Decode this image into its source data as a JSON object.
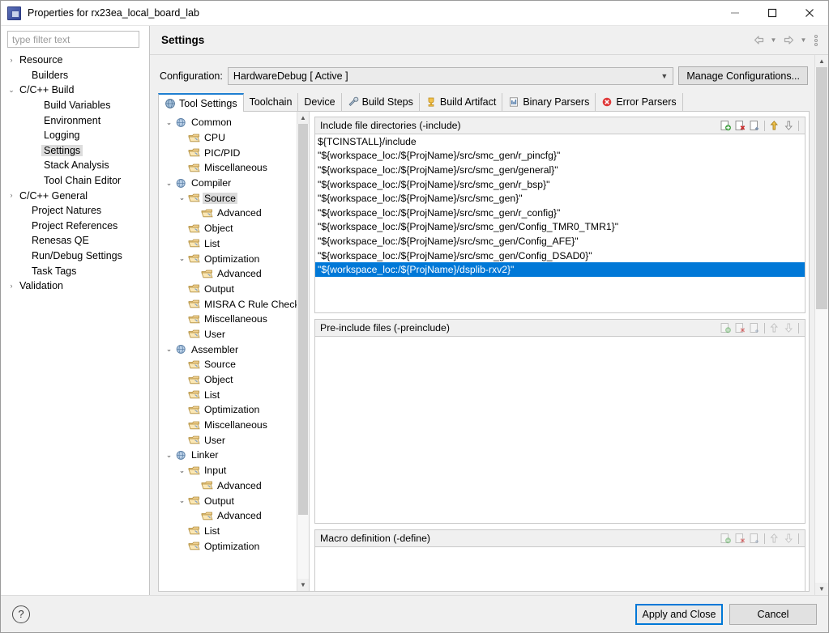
{
  "window": {
    "title": "Properties for rx23ea_local_board_lab",
    "app_icon": "chip-icon",
    "minimize_label": "—",
    "maximize_label": "□",
    "close_label": "✕"
  },
  "filter": {
    "placeholder": "type filter text",
    "value": ""
  },
  "sidebar": {
    "items": [
      {
        "label": "Resource",
        "indent": 0,
        "arrow": "collapsed",
        "selected": false
      },
      {
        "label": "Builders",
        "indent": 1,
        "arrow": "none",
        "selected": false
      },
      {
        "label": "C/C++ Build",
        "indent": 0,
        "arrow": "expanded",
        "selected": false
      },
      {
        "label": "Build Variables",
        "indent": 2,
        "arrow": "none",
        "selected": false
      },
      {
        "label": "Environment",
        "indent": 2,
        "arrow": "none",
        "selected": false
      },
      {
        "label": "Logging",
        "indent": 2,
        "arrow": "none",
        "selected": false
      },
      {
        "label": "Settings",
        "indent": 2,
        "arrow": "none",
        "selected": true
      },
      {
        "label": "Stack Analysis",
        "indent": 2,
        "arrow": "none",
        "selected": false
      },
      {
        "label": "Tool Chain Editor",
        "indent": 2,
        "arrow": "none",
        "selected": false
      },
      {
        "label": "C/C++ General",
        "indent": 0,
        "arrow": "collapsed",
        "selected": false
      },
      {
        "label": "Project Natures",
        "indent": 1,
        "arrow": "none",
        "selected": false
      },
      {
        "label": "Project References",
        "indent": 1,
        "arrow": "none",
        "selected": false
      },
      {
        "label": "Renesas QE",
        "indent": 1,
        "arrow": "none",
        "selected": false
      },
      {
        "label": "Run/Debug Settings",
        "indent": 1,
        "arrow": "none",
        "selected": false
      },
      {
        "label": "Task Tags",
        "indent": 1,
        "arrow": "none",
        "selected": false
      },
      {
        "label": "Validation",
        "indent": 0,
        "arrow": "collapsed",
        "selected": false
      }
    ]
  },
  "header": {
    "title": "Settings",
    "back_icon": "back-arrow-icon",
    "back_caret_icon": "chevron-down-icon",
    "forward_icon": "forward-arrow-icon",
    "forward_caret_icon": "chevron-down-icon",
    "menu_icon": "view-menu-icon"
  },
  "config": {
    "label": "Configuration:",
    "value": "HardwareDebug  [ Active ]",
    "caret_icon": "chevron-down-icon",
    "manage_button": "Manage Configurations..."
  },
  "tabs": [
    {
      "label": "Tool Settings",
      "icon": "tool-settings-icon",
      "active": true
    },
    {
      "label": "Toolchain",
      "icon": "none",
      "active": false
    },
    {
      "label": "Device",
      "icon": "none",
      "active": false
    },
    {
      "label": "Build Steps",
      "icon": "build-steps-icon",
      "active": false
    },
    {
      "label": "Build Artifact",
      "icon": "trophy-icon",
      "active": false
    },
    {
      "label": "Binary Parsers",
      "icon": "binary-parsers-icon",
      "active": false
    },
    {
      "label": "Error Parsers",
      "icon": "error-parsers-icon",
      "active": false
    }
  ],
  "tool_tree": [
    {
      "label": "Common",
      "indent": 0,
      "arrow": "expanded",
      "icon": "globe-icon",
      "selected": false
    },
    {
      "label": "CPU",
      "indent": 1,
      "arrow": "none",
      "icon": "folder-icon",
      "selected": false
    },
    {
      "label": "PIC/PID",
      "indent": 1,
      "arrow": "none",
      "icon": "folder-icon",
      "selected": false
    },
    {
      "label": "Miscellaneous",
      "indent": 1,
      "arrow": "none",
      "icon": "folder-icon",
      "selected": false
    },
    {
      "label": "Compiler",
      "indent": 0,
      "arrow": "expanded",
      "icon": "globe-icon",
      "selected": false
    },
    {
      "label": "Source",
      "indent": 1,
      "arrow": "expanded",
      "icon": "folder-icon",
      "selected": true
    },
    {
      "label": "Advanced",
      "indent": 2,
      "arrow": "none",
      "icon": "folder-icon",
      "selected": false
    },
    {
      "label": "Object",
      "indent": 1,
      "arrow": "none",
      "icon": "folder-icon",
      "selected": false
    },
    {
      "label": "List",
      "indent": 1,
      "arrow": "none",
      "icon": "folder-icon",
      "selected": false
    },
    {
      "label": "Optimization",
      "indent": 1,
      "arrow": "expanded",
      "icon": "folder-icon",
      "selected": false
    },
    {
      "label": "Advanced",
      "indent": 2,
      "arrow": "none",
      "icon": "folder-icon",
      "selected": false
    },
    {
      "label": "Output",
      "indent": 1,
      "arrow": "none",
      "icon": "folder-icon",
      "selected": false
    },
    {
      "label": "MISRA C Rule Check",
      "indent": 1,
      "arrow": "none",
      "icon": "folder-icon",
      "selected": false
    },
    {
      "label": "Miscellaneous",
      "indent": 1,
      "arrow": "none",
      "icon": "folder-icon",
      "selected": false
    },
    {
      "label": "User",
      "indent": 1,
      "arrow": "none",
      "icon": "folder-icon",
      "selected": false
    },
    {
      "label": "Assembler",
      "indent": 0,
      "arrow": "expanded",
      "icon": "globe-icon",
      "selected": false
    },
    {
      "label": "Source",
      "indent": 1,
      "arrow": "none",
      "icon": "folder-icon",
      "selected": false
    },
    {
      "label": "Object",
      "indent": 1,
      "arrow": "none",
      "icon": "folder-icon",
      "selected": false
    },
    {
      "label": "List",
      "indent": 1,
      "arrow": "none",
      "icon": "folder-icon",
      "selected": false
    },
    {
      "label": "Optimization",
      "indent": 1,
      "arrow": "none",
      "icon": "folder-icon",
      "selected": false
    },
    {
      "label": "Miscellaneous",
      "indent": 1,
      "arrow": "none",
      "icon": "folder-icon",
      "selected": false
    },
    {
      "label": "User",
      "indent": 1,
      "arrow": "none",
      "icon": "folder-icon",
      "selected": false
    },
    {
      "label": "Linker",
      "indent": 0,
      "arrow": "expanded",
      "icon": "globe-icon",
      "selected": false
    },
    {
      "label": "Input",
      "indent": 1,
      "arrow": "expanded",
      "icon": "folder-icon",
      "selected": false
    },
    {
      "label": "Advanced",
      "indent": 2,
      "arrow": "none",
      "icon": "folder-icon",
      "selected": false
    },
    {
      "label": "Output",
      "indent": 1,
      "arrow": "expanded",
      "icon": "folder-icon",
      "selected": false
    },
    {
      "label": "Advanced",
      "indent": 2,
      "arrow": "none",
      "icon": "folder-icon",
      "selected": false
    },
    {
      "label": "List",
      "indent": 1,
      "arrow": "none",
      "icon": "folder-icon",
      "selected": false
    },
    {
      "label": "Optimization",
      "indent": 1,
      "arrow": "none",
      "icon": "folder-icon",
      "selected": false
    }
  ],
  "sections": [
    {
      "title": "Include file directories (-include)",
      "enabled": true,
      "rows": [
        {
          "text": "${TCINSTALL}/include",
          "selected": false
        },
        {
          "text": "\"${workspace_loc:/${ProjName}/src/smc_gen/r_pincfg}\"",
          "selected": false
        },
        {
          "text": "\"${workspace_loc:/${ProjName}/src/smc_gen/general}\"",
          "selected": false
        },
        {
          "text": "\"${workspace_loc:/${ProjName}/src/smc_gen/r_bsp}\"",
          "selected": false
        },
        {
          "text": "\"${workspace_loc:/${ProjName}/src/smc_gen}\"",
          "selected": false
        },
        {
          "text": "\"${workspace_loc:/${ProjName}/src/smc_gen/r_config}\"",
          "selected": false
        },
        {
          "text": "\"${workspace_loc:/${ProjName}/src/smc_gen/Config_TMR0_TMR1}\"",
          "selected": false
        },
        {
          "text": "\"${workspace_loc:/${ProjName}/src/smc_gen/Config_AFE}\"",
          "selected": false
        },
        {
          "text": "\"${workspace_loc:/${ProjName}/src/smc_gen/Config_DSAD0}\"",
          "selected": false
        },
        {
          "text": "\"${workspace_loc:/${ProjName}/dsplib-rxv2}\"",
          "selected": true
        }
      ]
    },
    {
      "title": "Pre-include files (-preinclude)",
      "enabled": false,
      "rows": []
    },
    {
      "title": "Macro definition (-define)",
      "enabled": false,
      "rows": []
    }
  ],
  "section_tools": {
    "add": "add-icon",
    "delete": "delete-icon",
    "edit": "edit-icon",
    "move_up": "move-up-icon",
    "move_down": "move-down-icon"
  },
  "footer": {
    "help_icon": "help-icon",
    "apply_and_close": "Apply and Close",
    "cancel": "Cancel"
  },
  "colors": {
    "selection": "#0078d7",
    "active_tab_border": "#1f7fd1",
    "dialog_bg": "#f0f0f0"
  }
}
